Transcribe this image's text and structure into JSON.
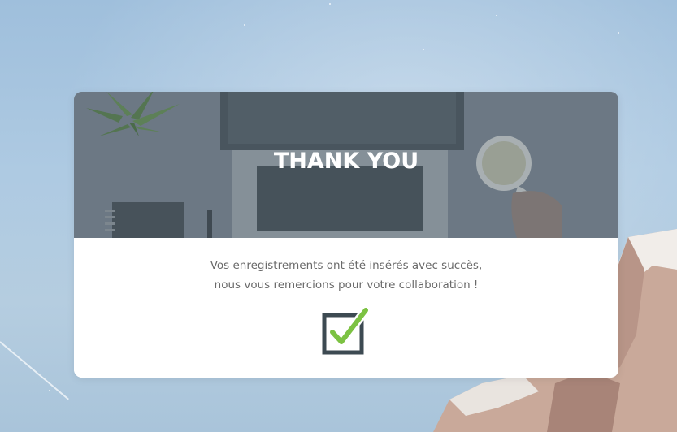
{
  "header": {
    "title": "THANK YOU"
  },
  "message": {
    "line1": "Vos enregistrements ont été insérés avec succès,",
    "line2": "nous vous remercions pour votre collaboration !"
  },
  "icons": {
    "success": "checkbox-checked-icon"
  },
  "colors": {
    "check_green": "#7cc242",
    "box_dark": "#3d4a52",
    "text_gray": "#6a6a6a",
    "header_overlay": "#6e7b86"
  }
}
